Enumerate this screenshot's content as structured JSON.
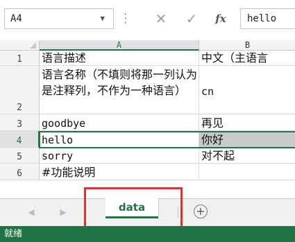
{
  "formula_bar": {
    "name_box": "A4",
    "name_box_dropdown_icon": "chevron-down-icon",
    "separator_icon": "vertical-ellipsis-icon",
    "cancel_icon": "close-icon",
    "enter_icon": "checkmark-icon",
    "function_icon": "function-fx-icon",
    "formula_text": "hello"
  },
  "columns": [
    {
      "label": "A"
    },
    {
      "label": "B"
    }
  ],
  "rows": [
    {
      "num": "1",
      "a": "语言描述",
      "b": "中文（主语言"
    },
    {
      "num": "2",
      "a": "语言名称（不填则将那一列认为是注释列，不作为一种语言）",
      "b": "cn"
    },
    {
      "num": "3",
      "a": "goodbye",
      "b": "再见"
    },
    {
      "num": "4",
      "a": "hello",
      "b": "你好"
    },
    {
      "num": "5",
      "a": "sorry",
      "b": "对不起"
    },
    {
      "num": "6",
      "a": "#功能说明",
      "b": ""
    }
  ],
  "selected_cell": "A4",
  "sheet_tabs": {
    "prev_icon": "triangle-left-icon",
    "next_icon": "triangle-right-icon",
    "active_tab": "data",
    "add_icon": "plus-circle-icon"
  },
  "status_bar": {
    "text": "就绪"
  },
  "colors": {
    "accent_green": "#217346",
    "highlight_red": "#e3312e",
    "selected_shade": "#c9c9c9"
  }
}
